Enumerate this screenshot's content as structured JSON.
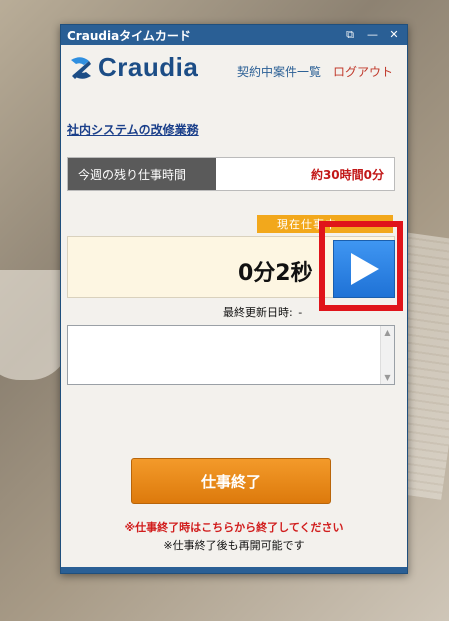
{
  "window": {
    "title": "Craudiaタイムカード",
    "buttons": {
      "restore": "⧉",
      "minimize": "—",
      "close": "✕"
    }
  },
  "header": {
    "logo_text": "Craudia",
    "nav": {
      "contracts": "契約中案件一覧",
      "logout": "ログアウト"
    }
  },
  "project": {
    "name": "社内システムの改修業務"
  },
  "remaining": {
    "label": "今週の残り仕事時間",
    "value": "約30時間0分"
  },
  "timer": {
    "status_label": "現在仕事中・・・",
    "elapsed": "0分2秒",
    "updated_label": "最終更新日時:",
    "updated_value": "-"
  },
  "memo": {
    "value": ""
  },
  "actions": {
    "end_label": "仕事終了"
  },
  "notes": {
    "warning": "※仕事終了時はこちらから終了してください",
    "info": "※仕事終了後も再開可能です"
  },
  "colors": {
    "titlebar": "#2a5f95",
    "accent_orange": "#f39a2a",
    "alert_red": "#c21818",
    "play_blue": "#2b84e6",
    "highlight_red": "#e0141a"
  },
  "icons": {
    "play": "play-icon",
    "logo": "craudia-logo-icon"
  }
}
